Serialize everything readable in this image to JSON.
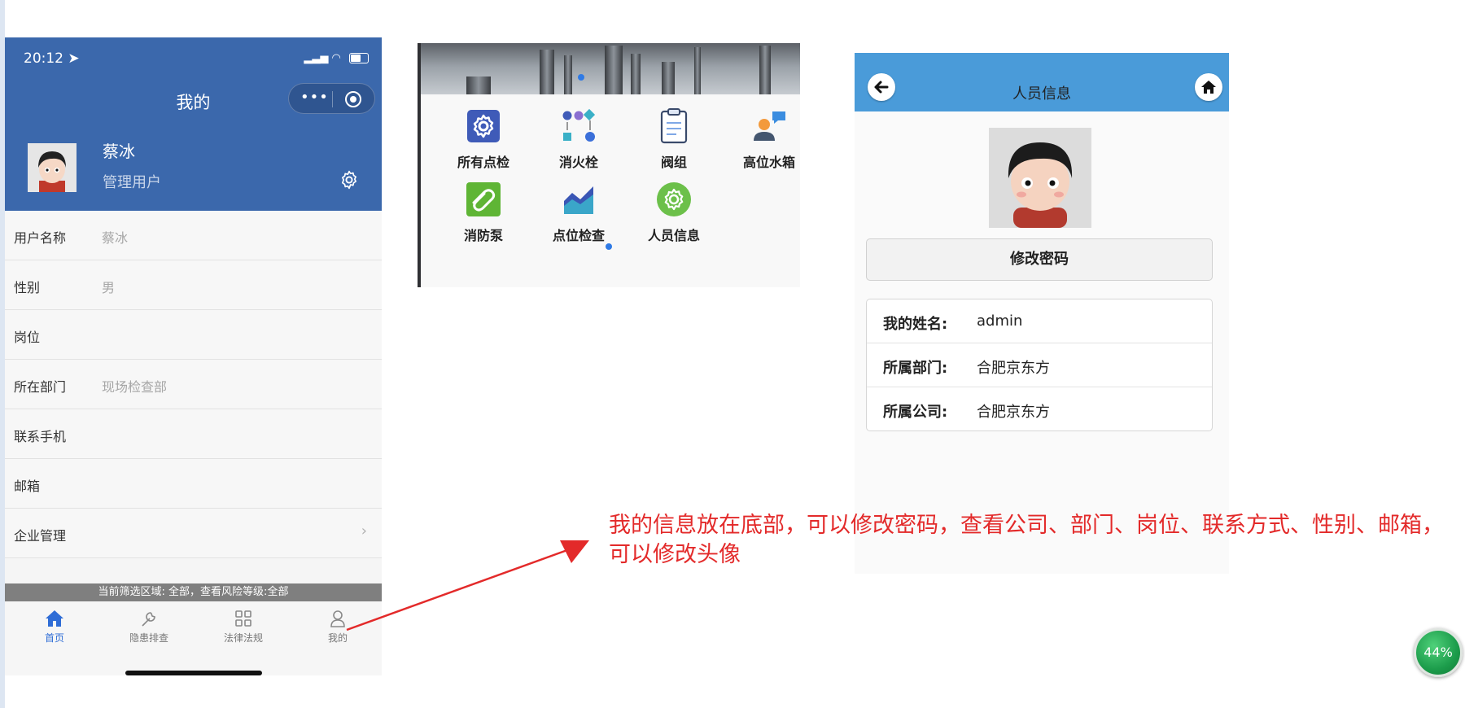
{
  "phone": {
    "status_time": "20:12",
    "nav_title": "我的",
    "profile": {
      "name": "蔡冰",
      "role": "管理用户"
    },
    "info_rows": [
      {
        "label": "用户名称",
        "value": "蔡冰"
      },
      {
        "label": "性别",
        "value": "男"
      },
      {
        "label": "岗位",
        "value": ""
      },
      {
        "label": "所在部门",
        "value": "现场检查部"
      },
      {
        "label": "联系手机",
        "value": ""
      },
      {
        "label": "邮箱",
        "value": ""
      },
      {
        "label": "企业管理",
        "value": ""
      }
    ],
    "filter_text": "当前筛选区域: 全部，查看风险等级:全部",
    "tabs": [
      {
        "label": "首页",
        "icon": "home-icon",
        "active": true
      },
      {
        "label": "隐患排查",
        "icon": "wrench-icon",
        "active": false
      },
      {
        "label": "法律法规",
        "icon": "grid-icon",
        "active": false
      },
      {
        "label": "我的",
        "icon": "person-icon",
        "active": false
      }
    ]
  },
  "grid": {
    "items": [
      {
        "label": "所有点检",
        "icon": "gear-square-icon"
      },
      {
        "label": "消火栓",
        "icon": "flow-nodes-icon"
      },
      {
        "label": "阀组",
        "icon": "clipboard-icon"
      },
      {
        "label": "高位水箱",
        "icon": "person-chat-icon"
      },
      {
        "label": "消防泵",
        "icon": "pump-icon"
      },
      {
        "label": "点位检查",
        "icon": "area-chart-icon"
      },
      {
        "label": "人员信息",
        "icon": "gear-circle-icon"
      }
    ]
  },
  "person": {
    "title": "人员信息",
    "change_password": "修改密码",
    "rows": [
      {
        "key": "我的姓名:",
        "value": "admin"
      },
      {
        "key": "所属部门:",
        "value": "合肥京东方"
      },
      {
        "key": "所属公司:",
        "value": "合肥京东方"
      }
    ]
  },
  "annotation": "我的信息放在底部，可以修改密码，查看公司、部门、岗位、联系方式、性别、邮箱，可以修改头像",
  "progress_badge": "44%",
  "colors": {
    "header_blue": "#3b68ac",
    "person_header": "#4a9bd9",
    "annotation_red": "#e32a2a",
    "tab_active": "#2f6dd6"
  }
}
